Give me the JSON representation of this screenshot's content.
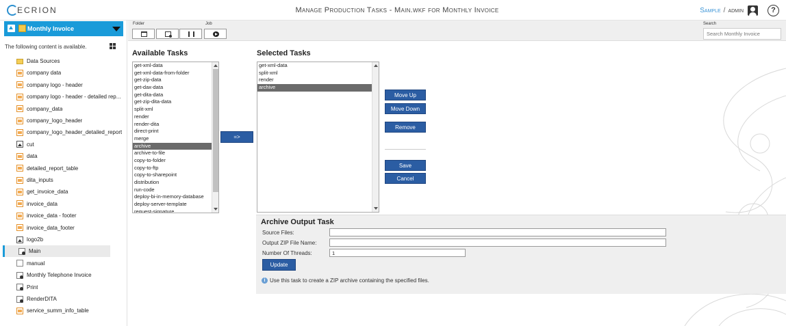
{
  "header": {
    "logo_text": "ECRION",
    "title": "Manage Production Tasks - Main.wkf for Monthly Invoice",
    "user_link": "Sample",
    "separator": "/",
    "user_name": "admin",
    "help_label": "?"
  },
  "sidebar": {
    "project_name": "Monthly Invoice",
    "message": "The following content is available.",
    "items": [
      {
        "label": "Data Sources",
        "icon": "folder-icon"
      },
      {
        "label": "company data",
        "icon": "file-icon"
      },
      {
        "label": "company logo - header",
        "icon": "file-icon"
      },
      {
        "label": "company logo - header - detailed rep...",
        "icon": "file-icon"
      },
      {
        "label": "company_data",
        "icon": "file-icon"
      },
      {
        "label": "company_logo_header",
        "icon": "file-icon"
      },
      {
        "label": "company_logo_header_detailed_report",
        "icon": "file-icon"
      },
      {
        "label": "cut",
        "icon": "image-icon"
      },
      {
        "label": "data",
        "icon": "file-icon"
      },
      {
        "label": "detailed_report_table",
        "icon": "file-icon"
      },
      {
        "label": "dita_inputs",
        "icon": "file-icon"
      },
      {
        "label": "get_invoice_data",
        "icon": "file-icon"
      },
      {
        "label": "invoice_data",
        "icon": "file-icon"
      },
      {
        "label": "invoice_data - footer",
        "icon": "file-icon"
      },
      {
        "label": "invoice_data_footer",
        "icon": "file-icon"
      },
      {
        "label": "logo2b",
        "icon": "image-icon"
      },
      {
        "label": "Main",
        "icon": "workflow-icon"
      },
      {
        "label": "manual",
        "icon": "document-icon"
      },
      {
        "label": "Monthly Telephone Invoice",
        "icon": "workflow-icon"
      },
      {
        "label": "Print",
        "icon": "workflow-icon"
      },
      {
        "label": "RenderDITA",
        "icon": "workflow-icon"
      },
      {
        "label": "service_summ_info_table",
        "icon": "file-icon"
      }
    ]
  },
  "toolbar": {
    "folder_label": "Folder",
    "job_label": "Job",
    "search_label": "Search",
    "search_placeholder": "Search Monthly Invoice"
  },
  "available_tasks": {
    "title": "Available Tasks",
    "items": [
      "get-xml-data",
      "get-xml-data-from-folder",
      "get-zip-data",
      "get-dax-data",
      "get-dita-data",
      "get-zip-dita-data",
      "split-xml",
      "render",
      "render-dita",
      "direct-print",
      "merge",
      "archive",
      "archive-to-file",
      "copy-to-folder",
      "copy-to-ftp",
      "copy-to-sharepoint",
      "distribution",
      "run-code",
      "deploy-bi-in-memory-database",
      "deploy-server-template",
      "request-signature"
    ],
    "selected": "archive"
  },
  "add_button_label": "=>",
  "selected_tasks": {
    "title": "Selected Tasks",
    "items": [
      "get-xml-data",
      "split-xml",
      "render",
      "archive"
    ],
    "selected": "archive"
  },
  "actions": {
    "move_up": "Move Up",
    "move_down": "Move Down",
    "remove": "Remove",
    "save": "Save",
    "cancel": "Cancel"
  },
  "archive_panel": {
    "title": "Archive Output Task",
    "source_files_label": "Source Files:",
    "source_files_value": "",
    "output_zip_label": "Output ZIP File Name:",
    "output_zip_value": "",
    "threads_label": "Number Of Threads:",
    "threads_value": "1",
    "update_label": "Update",
    "info_text": "Use this task to create a ZIP archive containing the specified files."
  }
}
